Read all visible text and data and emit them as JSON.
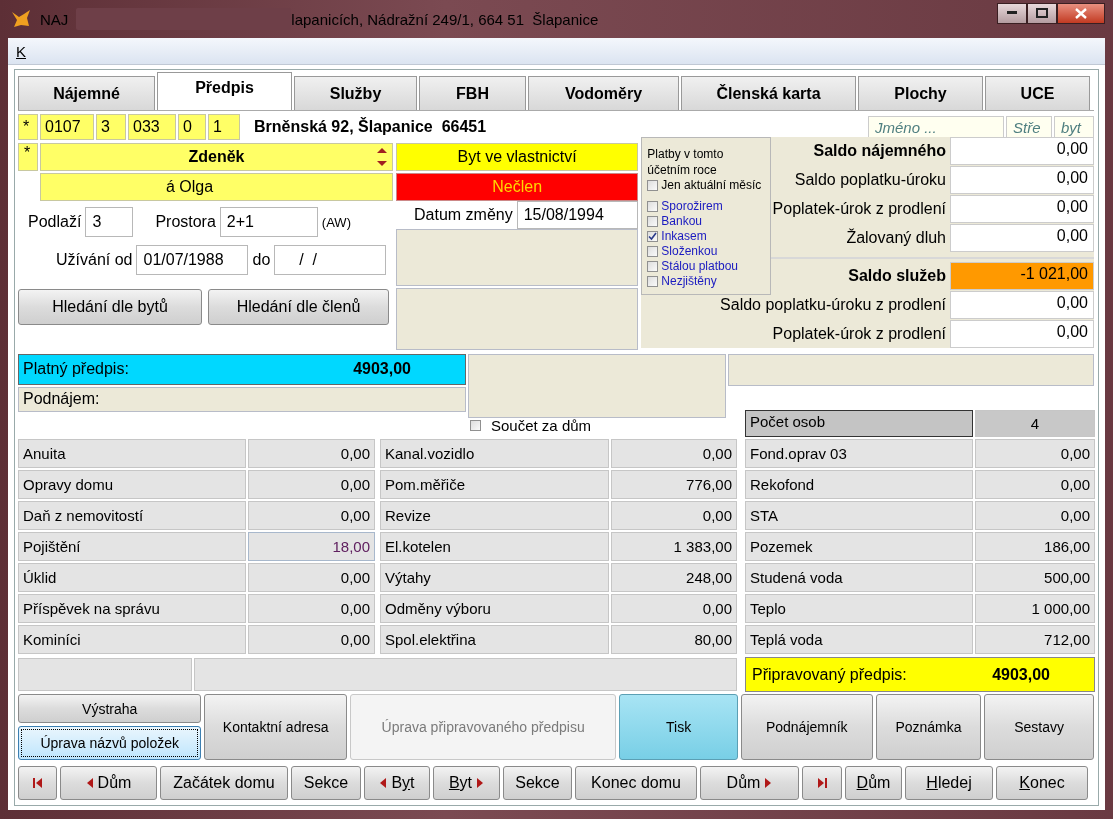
{
  "window": {
    "app_name": "NAJ",
    "title": "lapanicích, Nádražní 249/1, 664 51  Šlapanice"
  },
  "menu": [
    {
      "hotkey": "K"
    }
  ],
  "tabs": [
    {
      "label": "Nájemné",
      "selected": false
    },
    {
      "label": "Předpis",
      "selected": true
    },
    {
      "label": "Služby",
      "selected": false
    },
    {
      "label": "FBH",
      "selected": false
    },
    {
      "label": "Vodoměry",
      "selected": false
    },
    {
      "label": "Členská karta",
      "selected": false
    },
    {
      "label": "Plochy",
      "selected": false
    },
    {
      "label": "UCE",
      "selected": false
    }
  ],
  "record": {
    "codes": [
      "*",
      "0107",
      "3",
      "033",
      "0",
      "1"
    ],
    "address": "Brněnská 92, Šlapanice  66451"
  },
  "search_fields": [
    {
      "placeholder": "Jméno ..."
    },
    {
      "placeholder": "Stře"
    },
    {
      "placeholder": "byt"
    }
  ],
  "person": {
    "marker": "*",
    "first_name": "Zdeněk",
    "second_name": "á Olga"
  },
  "ownership": "Byt ve vlastnictví",
  "membership": "Nečlen",
  "floor": {
    "label": "Podlaží",
    "value": "3"
  },
  "space": {
    "label": "Prostora",
    "value": "2+1",
    "note": "(AW)"
  },
  "usage": {
    "label": "Užívání od",
    "from": "01/07/1988",
    "to_label": "do",
    "to": "/  /"
  },
  "change_date": {
    "label": "Datum změny",
    "value": "15/08/1994"
  },
  "search_buttons": [
    "Hledání dle bytů",
    "Hledání dle členů"
  ],
  "payments": {
    "title": "Platby v tomto účetním roce",
    "current_month": {
      "label": "Jen aktuální měsíc",
      "checked": false
    },
    "methods": [
      {
        "label": "Sporožirem",
        "checked": false
      },
      {
        "label": "Bankou",
        "checked": false
      },
      {
        "label": "Inkasem",
        "checked": true
      },
      {
        "label": "Složenkou",
        "checked": false
      },
      {
        "label": "Stálou platbou",
        "checked": false
      },
      {
        "label": "Nezjištěny",
        "checked": false
      }
    ]
  },
  "balance_groups": [
    [
      {
        "label": "Saldo nájemného",
        "value": "0,00",
        "kind": "header",
        "alert": false
      },
      {
        "label": "Saldo poplatku-úroku",
        "value": "0,00",
        "kind": "row",
        "alert": false
      },
      {
        "label": "Poplatek-úrok z prodlení",
        "value": "0,00",
        "kind": "row",
        "alert": false
      },
      {
        "label": "Žalovaný dluh",
        "value": "0,00",
        "kind": "row",
        "alert": false
      }
    ],
    [
      {
        "label": "Saldo služeb",
        "value": "-1 021,00",
        "kind": "header",
        "alert": true
      },
      {
        "label": "Saldo poplatku-úroku z prodlení",
        "value": "0,00",
        "kind": "row",
        "alert": false
      },
      {
        "label": "Poplatek-úrok z prodlení",
        "value": "0,00",
        "kind": "row",
        "alert": false
      }
    ]
  ],
  "valid_prescription": {
    "label": "Platný předpis:",
    "value": "4903,00"
  },
  "sublease": {
    "label": "Podnájem:"
  },
  "house_total": {
    "label": "Součet za dům",
    "checked": false
  },
  "items_left": [
    {
      "label": "Anuita",
      "value": "0,00",
      "focused": false
    },
    {
      "label": "Opravy domu",
      "value": "0,00",
      "focused": false
    },
    {
      "label": "Daň z nemovitostí",
      "value": "0,00",
      "focused": false
    },
    {
      "label": "Pojištění",
      "value": "18,00",
      "focused": true
    },
    {
      "label": "Úklid",
      "value": "0,00",
      "focused": false
    },
    {
      "label": "Příspěvek na správu",
      "value": "0,00",
      "focused": false
    },
    {
      "label": "Kominíci",
      "value": "0,00",
      "focused": false
    }
  ],
  "items_middle": [
    {
      "label": "Kanal.vozidlo",
      "value": "0,00"
    },
    {
      "label": "Pom.měřiče",
      "value": "776,00"
    },
    {
      "label": "Revize",
      "value": "0,00"
    },
    {
      "label": "El.kotelen",
      "value": "1 383,00"
    },
    {
      "label": "Výtahy",
      "value": "248,00"
    },
    {
      "label": "Odměny výboru",
      "value": "0,00"
    },
    {
      "label": "Spol.elektřina",
      "value": "80,00"
    }
  ],
  "persons": {
    "label": "Počet osob",
    "value": "4"
  },
  "items_right": [
    {
      "label": "Fond.oprav 03",
      "value": "0,00"
    },
    {
      "label": "Rekofond",
      "value": "0,00"
    },
    {
      "label": "STA",
      "value": "0,00"
    },
    {
      "label": "Pozemek",
      "value": "186,00"
    },
    {
      "label": "Studená voda",
      "value": "500,00"
    },
    {
      "label": "Teplo",
      "value": "1 000,00"
    },
    {
      "label": "Teplá voda",
      "value": "712,00"
    }
  ],
  "prepared_prescription": {
    "label": "Připravovaný předpis:",
    "value": "4903,00"
  },
  "side_actions": [
    {
      "label": "Výstraha",
      "focused": false
    },
    {
      "label": "Úprava názvů položek",
      "focused": true
    }
  ],
  "actions": [
    {
      "label": "Kontaktní adresa",
      "kind": "normal"
    },
    {
      "label": "Úprava připravovaného předpisu",
      "kind": "disabled"
    },
    {
      "label": "Tisk",
      "kind": "highlighted"
    },
    {
      "label": "Podnájemník",
      "kind": "normal"
    },
    {
      "label": "Poznámka",
      "kind": "normal"
    },
    {
      "label": "Sestavy",
      "kind": "normal"
    }
  ],
  "navigation": [
    {
      "kind": "first"
    },
    {
      "kind": "prev",
      "label": "Dům"
    },
    {
      "kind": "plain",
      "label": "Začátek domu"
    },
    {
      "kind": "plain",
      "label": "Sekce"
    },
    {
      "kind": "prev",
      "before": "B",
      "hotkey": "y",
      "after": "t"
    },
    {
      "kind": "next",
      "hotkey": "B",
      "after": "yt"
    },
    {
      "kind": "plain",
      "label": "Sekce"
    },
    {
      "kind": "plain",
      "label": "Konec domu"
    },
    {
      "kind": "next",
      "label": "Dům"
    },
    {
      "kind": "last"
    },
    {
      "kind": "plain",
      "hotkey": "D",
      "after": "ům"
    },
    {
      "kind": "plain",
      "hotkey": "H",
      "after": "ledej"
    },
    {
      "kind": "plain",
      "hotkey": "K",
      "after": "onec"
    }
  ]
}
